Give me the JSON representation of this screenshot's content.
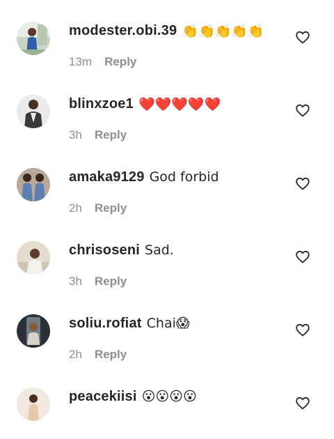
{
  "comments": [
    {
      "username": "modester.obi.39",
      "text": "👏👏👏👏👏",
      "time": "13m",
      "reply_label": "Reply",
      "avatar_icon": "user-avatar-photo",
      "like_icon": "heart-outline-icon"
    },
    {
      "username": "blinxzoe1",
      "text": "❤️❤️❤️❤️❤️",
      "time": "3h",
      "reply_label": "Reply",
      "avatar_icon": "user-avatar-photo",
      "like_icon": "heart-outline-icon"
    },
    {
      "username": "amaka9129",
      "text": "God forbid",
      "time": "2h",
      "reply_label": "Reply",
      "avatar_icon": "user-avatar-photo",
      "like_icon": "heart-outline-icon"
    },
    {
      "username": "chrisoseni",
      "text": "Sad.",
      "time": "3h",
      "reply_label": "Reply",
      "avatar_icon": "user-avatar-photo",
      "like_icon": "heart-outline-icon"
    },
    {
      "username": "soliu.rofiat",
      "text": "Chai😱",
      "time": "2h",
      "reply_label": "Reply",
      "avatar_icon": "user-avatar-photo",
      "like_icon": "heart-outline-icon"
    },
    {
      "username": "peacekiisi",
      "text": "😮😮😮😮",
      "time": "",
      "reply_label": "",
      "avatar_icon": "user-avatar-photo",
      "like_icon": "heart-outline-icon"
    }
  ],
  "colors": {
    "username": "#262626",
    "meta": "#8e8e8e",
    "background": "#ffffff"
  }
}
